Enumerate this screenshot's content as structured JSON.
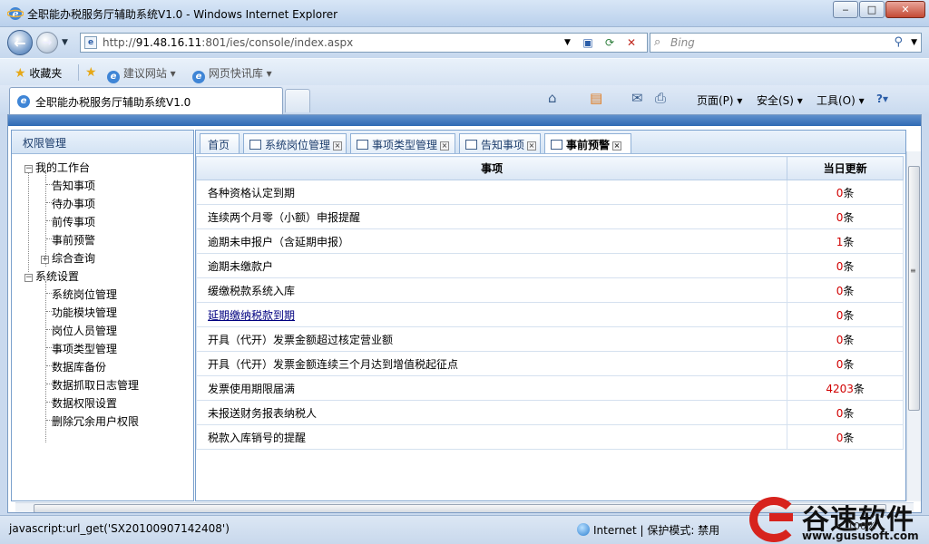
{
  "window": {
    "title": "全职能办税服务厅辅助系统V1.0 - Windows Internet Explorer",
    "minimize": "‒",
    "maximize": "□",
    "close": "✕"
  },
  "address": {
    "url_prefix": "http://",
    "url_host": "91.48.16.11",
    "url_rest": ":801/ies/console/index.aspx"
  },
  "search": {
    "placeholder": "Bing"
  },
  "favorites": {
    "favorites_label": "收藏夹",
    "items": [
      "建议网站 ▾",
      "网页快讯库 ▾"
    ]
  },
  "browser_tab": {
    "label": "全职能办税服务厅辅助系统V1.0"
  },
  "commands": {
    "page": "页面(P) ▾",
    "safety": "安全(S) ▾",
    "tools": "工具(O) ▾",
    "help": "?▾"
  },
  "sidebar": {
    "title": "权限管理",
    "groups": [
      {
        "label": "我的工作台",
        "toggle": "−",
        "items": [
          "告知事项",
          "待办事项",
          "前传事项",
          "事前预警"
        ],
        "sub_label": "综合查询",
        "sub_toggle": "+"
      },
      {
        "label": "系统设置",
        "toggle": "−",
        "items": [
          "系统岗位管理",
          "功能模块管理",
          "岗位人员管理",
          "事项类型管理",
          "数据库备份",
          "数据抓取日志管理",
          "数据权限设置",
          "删除冗余用户权限"
        ]
      }
    ]
  },
  "tabs": [
    {
      "label": "首页"
    },
    {
      "label": "系统岗位管理",
      "close": "×"
    },
    {
      "label": "事项类型管理",
      "close": "×"
    },
    {
      "label": "告知事项",
      "close": "×"
    },
    {
      "label": "事前预警",
      "close": "×",
      "active": true
    }
  ],
  "table": {
    "headers": [
      "事项",
      "当日更新"
    ],
    "unit": "条",
    "rows": [
      {
        "item": "各种资格认定到期",
        "count": "0"
      },
      {
        "item": "连续两个月零（小额）申报提醒",
        "count": "0"
      },
      {
        "item": "逾期未申报户（含延期申报）",
        "count": "1"
      },
      {
        "item": "逾期未缴款户",
        "count": "0"
      },
      {
        "item": "缓缴税款系统入库",
        "count": "0"
      },
      {
        "item": "延期缴纳税款到期",
        "count": "0",
        "link": true
      },
      {
        "item": "开具（代开）发票金额超过核定营业额",
        "count": "0"
      },
      {
        "item": "开具（代开）发票金额连续三个月达到增值税起征点",
        "count": "0"
      },
      {
        "item": "发票使用期限届满",
        "count": "4203"
      },
      {
        "item": "未报送财务报表纳税人",
        "count": "0"
      },
      {
        "item": "税款入库销号的提醒",
        "count": "0"
      }
    ]
  },
  "status": {
    "text": "javascript:url_get('SX20100907142408')",
    "zone": "Internet | 保护模式: 禁用",
    "zoom": "100%"
  },
  "watermark": {
    "cn": "谷速软件",
    "en": "www.gususoft.com"
  }
}
